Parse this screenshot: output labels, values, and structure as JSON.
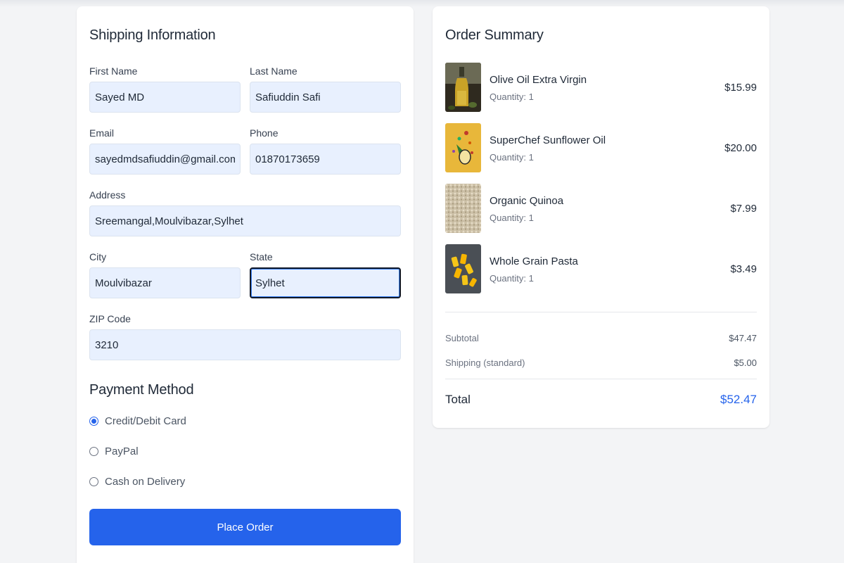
{
  "shipping": {
    "title": "Shipping Information",
    "first_name": {
      "label": "First Name",
      "value": "Sayed MD"
    },
    "last_name": {
      "label": "Last Name",
      "value": "Safiuddin Safi"
    },
    "email": {
      "label": "Email",
      "value": "sayedmdsafiuddin@gmail.com"
    },
    "phone": {
      "label": "Phone",
      "value": "01870173659"
    },
    "address": {
      "label": "Address",
      "value": "Sreemangal,Moulvibazar,Sylhet"
    },
    "city": {
      "label": "City",
      "value": "Moulvibazar"
    },
    "state": {
      "label": "State",
      "value": "Sylhet"
    },
    "zip": {
      "label": "ZIP Code",
      "value": "3210"
    }
  },
  "payment": {
    "title": "Payment Method",
    "options": [
      {
        "label": "Credit/Debit Card",
        "checked": true
      },
      {
        "label": "PayPal",
        "checked": false
      },
      {
        "label": "Cash on Delivery",
        "checked": false
      }
    ],
    "place_order_label": "Place Order"
  },
  "summary": {
    "title": "Order Summary",
    "items": [
      {
        "name": "Olive Oil Extra Virgin",
        "quantity": "Quantity: 1",
        "price": "$15.99",
        "image": "olive-oil-bottle-image"
      },
      {
        "name": "SuperChef Sunflower Oil",
        "quantity": "Quantity: 1",
        "price": "$20.00",
        "image": "sunflower-oil-image"
      },
      {
        "name": "Organic Quinoa",
        "quantity": "Quantity: 1",
        "price": "$7.99",
        "image": "quinoa-image"
      },
      {
        "name": "Whole Grain Pasta",
        "quantity": "Quantity: 1",
        "price": "$3.49",
        "image": "pasta-image"
      }
    ],
    "subtotal_label": "Subtotal",
    "subtotal_value": "$47.47",
    "shipping_label": "Shipping (standard)",
    "shipping_value": "$5.00",
    "total_label": "Total",
    "total_value": "$52.47"
  },
  "colors": {
    "accent": "#2563eb",
    "input_bg": "#e8f0fe",
    "page_bg": "#f3f4f6"
  }
}
